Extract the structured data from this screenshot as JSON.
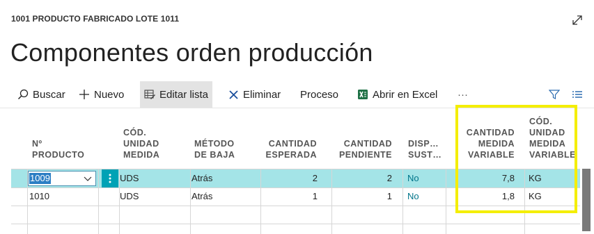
{
  "caption": "1001 PRODUCTO FABRICADO LOTE 1011",
  "title": "Componentes orden producción",
  "toolbar": {
    "search": "Buscar",
    "new": "Nuevo",
    "edit_list": "Editar lista",
    "delete": "Eliminar",
    "process": "Proceso",
    "excel": "Abrir en Excel",
    "more": "···"
  },
  "columns": {
    "product_no": [
      "Nº",
      "PRODUCTO"
    ],
    "uom_code": [
      "CÓD.",
      "UNIDAD",
      "MEDIDA"
    ],
    "flush_method": [
      "MÉTODO",
      "DE BAJA"
    ],
    "expected_qty": [
      "CANTIDAD",
      "ESPERADA"
    ],
    "remaining_qty": [
      "CANTIDAD",
      "PENDIENTE"
    ],
    "substitute": [
      "DISP…",
      "SUST…"
    ],
    "variable_qty": [
      "CANTIDAD",
      "MEDIDA",
      "VARIABLE"
    ],
    "variable_uom": [
      "CÓD.",
      "UNIDAD",
      "MEDIDA",
      "VARIABLE"
    ]
  },
  "rows": [
    {
      "product_no": "1009",
      "uom": "UDS",
      "method": "Atrás",
      "expected": "2",
      "remaining": "2",
      "substitute": "No",
      "var_qty": "7,8",
      "var_uom": "KG"
    },
    {
      "product_no": "1010",
      "uom": "UDS",
      "method": "Atrás",
      "expected": "1",
      "remaining": "1",
      "substitute": "No",
      "var_qty": "1,8",
      "var_uom": "KG"
    }
  ],
  "colors": {
    "accent": "#00a2b5",
    "selected_row": "#a4e4e7",
    "highlight": "#f4ee00",
    "link": "#00758a"
  }
}
